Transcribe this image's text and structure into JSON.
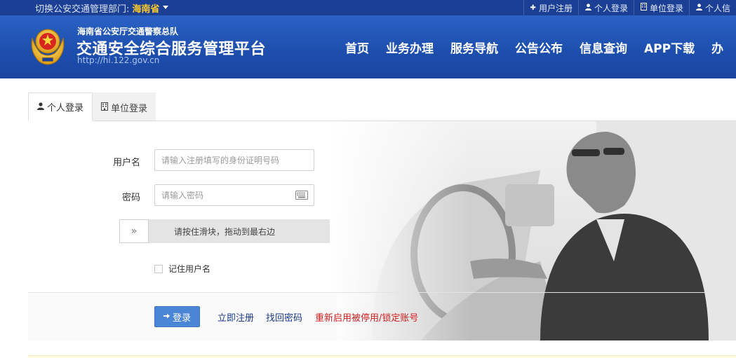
{
  "topbar": {
    "dept_label": "切换公安交通管理部门:",
    "province": "海南省",
    "links": [
      {
        "icon": "plus-icon",
        "glyph": "✚",
        "label": "用户注册"
      },
      {
        "icon": "user-icon",
        "glyph": "👤",
        "label": "个人登录"
      },
      {
        "icon": "building-icon",
        "glyph": "▦",
        "label": "单位登录"
      },
      {
        "icon": "user-icon",
        "glyph": "👤",
        "label": "个人信"
      }
    ]
  },
  "header": {
    "org": "海南省公安厅交通警察总队",
    "title": "交通安全综合服务管理平台",
    "url": "http://hi.122.gov.cn",
    "nav": [
      "首页",
      "业务办理",
      "服务导航",
      "公告公布",
      "信息查询",
      "APP下载",
      "办"
    ]
  },
  "tabs": [
    {
      "label": "个人登录",
      "icon": "user-icon",
      "active": true
    },
    {
      "label": "单位登录",
      "icon": "building-icon",
      "active": false
    }
  ],
  "form": {
    "username_label": "用户名",
    "username_placeholder": "请输入注册填写的身份证明号码",
    "password_label": "密码",
    "password_placeholder": "请输入密码",
    "slider_handle": "»",
    "slider_text": "请按住滑块，拖动到最右边",
    "remember_label": "记住用户名",
    "remember_checked": false
  },
  "actions": {
    "login": "登录",
    "register": "立即注册",
    "find_password": "找回密码",
    "reactivate": "重新启用被停用/锁定账号"
  },
  "colors": {
    "header_blue": "#1e4fae",
    "topbar_blue": "#1b3f95",
    "province_gold": "#ffc928",
    "login_button": "#4a85d6",
    "link_red": "#d42020"
  }
}
